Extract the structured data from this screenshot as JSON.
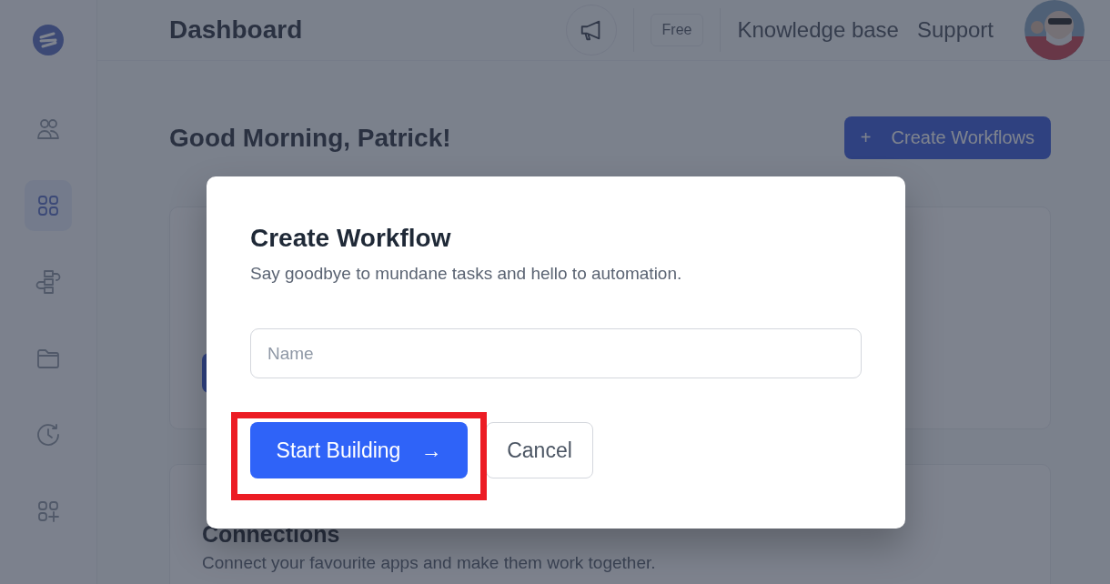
{
  "sidebar": {
    "items": [
      {
        "selected": false
      },
      {
        "selected": true
      },
      {
        "selected": false
      },
      {
        "selected": false
      },
      {
        "selected": false
      },
      {
        "selected": false
      }
    ]
  },
  "header": {
    "title": "Dashboard",
    "plan_badge": "Free",
    "links": [
      "Knowledge base",
      "Support"
    ]
  },
  "greeting": "Good Morning, Patrick!",
  "create_button": {
    "icon": "+",
    "label": "Create Workflows"
  },
  "connections_card": {
    "title": "Connections",
    "description": "Connect your favourite apps and make them work together."
  },
  "dialog": {
    "title": "Create Workflow",
    "subtitle": "Say goodbye to mundane tasks and hello to automation.",
    "name_field": {
      "placeholder": "Name"
    },
    "primary_button": {
      "label": "Start Building",
      "icon": "→",
      "highlighted": true
    },
    "cancel_button": "Cancel"
  }
}
